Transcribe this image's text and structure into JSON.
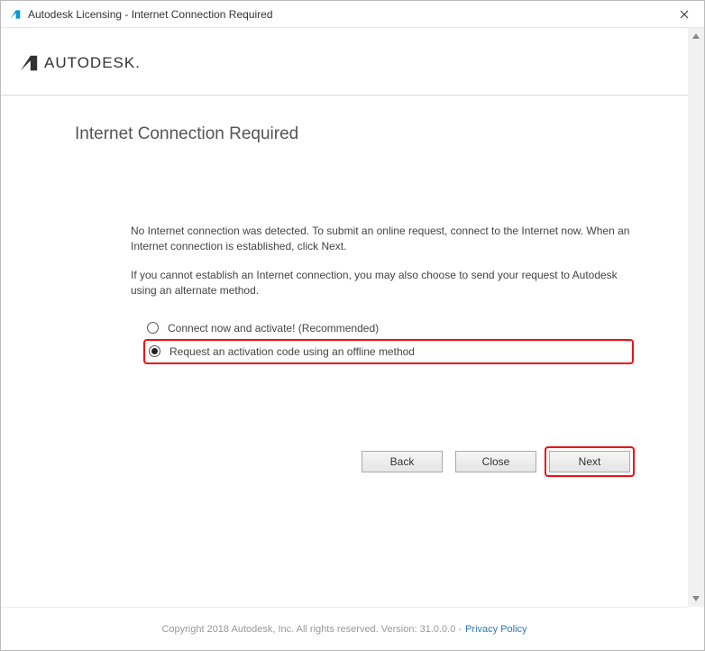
{
  "window": {
    "title": "Autodesk Licensing - Internet Connection Required"
  },
  "brand": {
    "name": "AUTODESK"
  },
  "page": {
    "heading": "Internet Connection Required",
    "para1": "No Internet connection was detected. To submit an online request, connect to the Internet now. When an Internet connection is established, click Next.",
    "para2": "If you cannot establish an Internet connection, you may also choose to send your request to Autodesk using an alternate method."
  },
  "options": {
    "connect_label": "Connect now and activate! (Recommended)",
    "offline_label": "Request an activation code using an offline method",
    "selected": "offline"
  },
  "buttons": {
    "back": "Back",
    "close": "Close",
    "next": "Next"
  },
  "footer": {
    "copyright": "Copyright 2018 Autodesk, Inc. All rights reserved. Version: 31.0.0.0 - ",
    "privacy": "Privacy Policy"
  }
}
